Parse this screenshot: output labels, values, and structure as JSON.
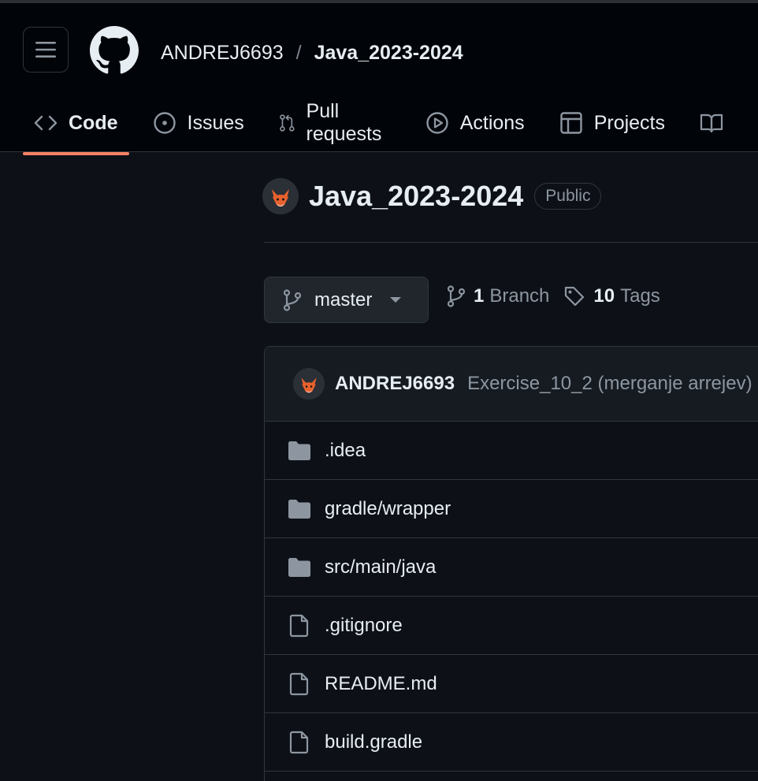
{
  "header": {
    "owner": "ANDREJ6693",
    "separator": "/",
    "repo": "Java_2023-2024"
  },
  "nav": {
    "tabs": [
      {
        "label": "Code",
        "icon": "code-icon",
        "active": true
      },
      {
        "label": "Issues",
        "icon": "issue-circle-icon"
      },
      {
        "label": "Pull requests",
        "icon": "pull-request-icon"
      },
      {
        "label": "Actions",
        "icon": "play-circle-icon"
      },
      {
        "label": "Projects",
        "icon": "table-icon"
      }
    ]
  },
  "repo": {
    "title": "Java_2023-2024",
    "visibility": "Public"
  },
  "branch": {
    "name": "master",
    "branch_count": "1",
    "branch_label": "Branch",
    "tag_count": "10",
    "tag_label": "Tags"
  },
  "latest_commit": {
    "author": "ANDREJ6693",
    "message": "Exercise_10_2 (merganje arrejev)"
  },
  "files": [
    {
      "name": ".idea",
      "type": "folder"
    },
    {
      "name": "gradle/wrapper",
      "type": "folder"
    },
    {
      "name": "src/main/java",
      "type": "folder"
    },
    {
      "name": ".gitignore",
      "type": "file"
    },
    {
      "name": "README.md",
      "type": "file"
    },
    {
      "name": "build.gradle",
      "type": "file"
    }
  ],
  "colors": {
    "background": "#0d1117",
    "header_background": "#010409",
    "border": "#30363d",
    "active_tab_underline": "#f78166",
    "muted_text": "#8d96a0",
    "icon": "#8d96a0"
  }
}
